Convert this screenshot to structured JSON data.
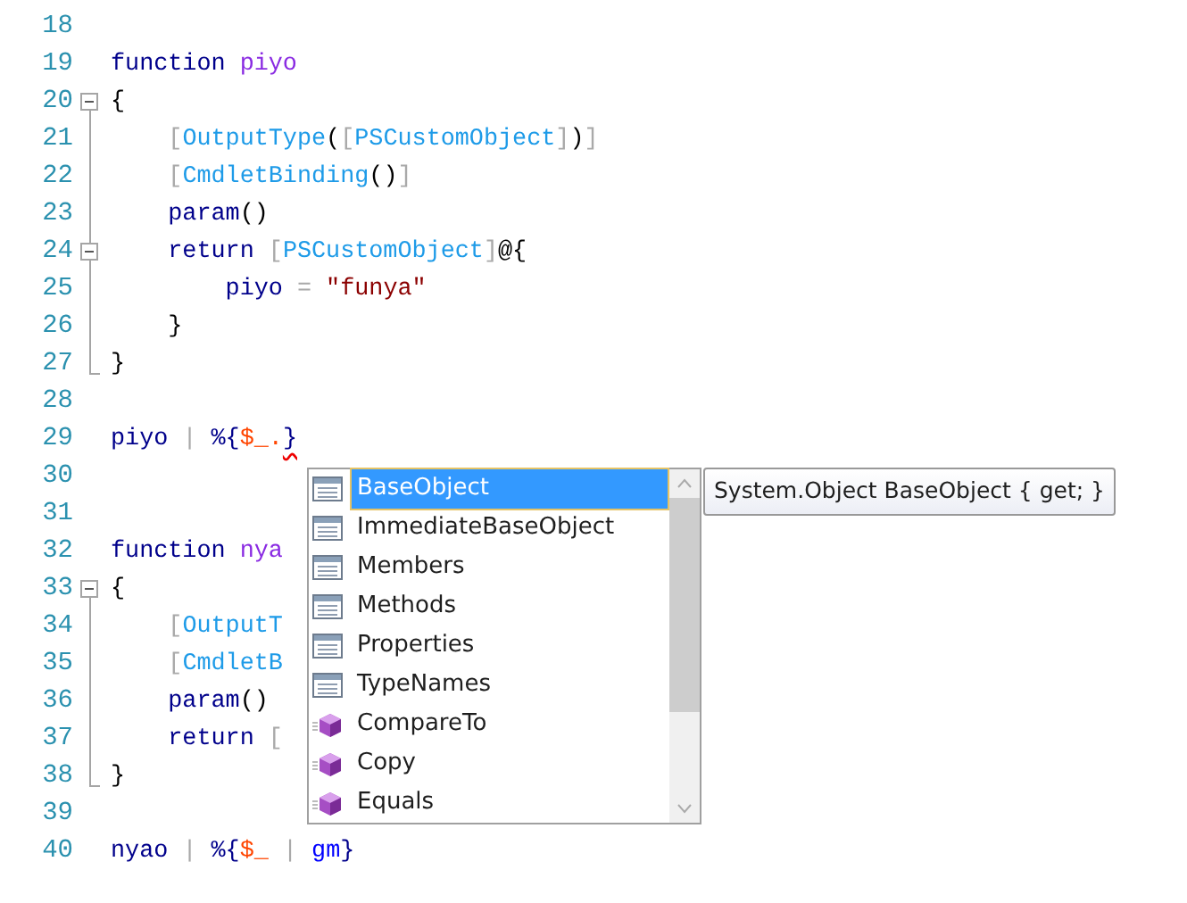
{
  "editor": {
    "lines": [
      {
        "number": "18"
      },
      {
        "number": "19",
        "tokens": [
          {
            "t": "function ",
            "kind": "keyword"
          },
          {
            "t": "piyo",
            "kind": "name"
          }
        ]
      },
      {
        "number": "20",
        "collapsible": true,
        "tokens": [
          {
            "t": "{",
            "kind": "punct"
          }
        ]
      },
      {
        "number": "21",
        "tokens": [
          {
            "t": "    [",
            "kind": "bracket"
          },
          {
            "t": "OutputType",
            "kind": "type"
          },
          {
            "t": "(",
            "kind": "punct"
          },
          {
            "t": "[",
            "kind": "bracket"
          },
          {
            "t": "PSCustomObject",
            "kind": "type"
          },
          {
            "t": "]",
            "kind": "bracket"
          },
          {
            "t": ")",
            "kind": "punct"
          },
          {
            "t": "]",
            "kind": "bracket"
          }
        ]
      },
      {
        "number": "22",
        "tokens": [
          {
            "t": "    [",
            "kind": "bracket"
          },
          {
            "t": "CmdletBinding",
            "kind": "type"
          },
          {
            "t": "()",
            "kind": "punct"
          },
          {
            "t": "]",
            "kind": "bracket"
          }
        ]
      },
      {
        "number": "23",
        "tokens": [
          {
            "t": "    param",
            "kind": "keyword"
          },
          {
            "t": "()",
            "kind": "punct"
          }
        ]
      },
      {
        "number": "24",
        "collapsible": true,
        "tokens": [
          {
            "t": "    return",
            "kind": "keyword"
          },
          {
            "t": " [",
            "kind": "bracket"
          },
          {
            "t": "PSCustomObject",
            "kind": "type"
          },
          {
            "t": "]",
            "kind": "bracket"
          },
          {
            "t": "@{",
            "kind": "punct"
          }
        ]
      },
      {
        "number": "25",
        "tokens": [
          {
            "t": "        piyo",
            "kind": "keyword"
          },
          {
            "t": " = ",
            "kind": "operator"
          },
          {
            "t": "\"funya\"",
            "kind": "string"
          }
        ]
      },
      {
        "number": "26",
        "tokens": [
          {
            "t": "    }",
            "kind": "punct"
          }
        ]
      },
      {
        "number": "27",
        "fold_end": true,
        "tokens": [
          {
            "t": "}",
            "kind": "punct"
          }
        ]
      },
      {
        "number": "28"
      },
      {
        "number": "29",
        "tokens": [
          {
            "t": "piyo",
            "kind": "keyword"
          },
          {
            "t": " | ",
            "kind": "operator"
          },
          {
            "t": "%{",
            "kind": "keyword"
          },
          {
            "t": "$_.",
            "kind": "variable"
          },
          {
            "t": "}",
            "kind": "keyword",
            "error": true
          }
        ]
      },
      {
        "number": "30"
      },
      {
        "number": "31"
      },
      {
        "number": "32",
        "tokens": [
          {
            "t": "function ",
            "kind": "keyword"
          },
          {
            "t": "nya",
            "kind": "name"
          }
        ]
      },
      {
        "number": "33",
        "collapsible": true,
        "tokens": [
          {
            "t": "{",
            "kind": "punct"
          }
        ]
      },
      {
        "number": "34",
        "tokens": [
          {
            "t": "    [",
            "kind": "bracket"
          },
          {
            "t": "OutputT",
            "kind": "type"
          }
        ]
      },
      {
        "number": "35",
        "tokens": [
          {
            "t": "    [",
            "kind": "bracket"
          },
          {
            "t": "CmdletB",
            "kind": "type"
          }
        ]
      },
      {
        "number": "36",
        "tokens": [
          {
            "t": "    param",
            "kind": "keyword"
          },
          {
            "t": "()",
            "kind": "punct"
          }
        ]
      },
      {
        "number": "37",
        "tokens": [
          {
            "t": "    return",
            "kind": "keyword"
          },
          {
            "t": " [",
            "kind": "bracket"
          }
        ]
      },
      {
        "number": "38",
        "fold_end": true,
        "tokens": [
          {
            "t": "}",
            "kind": "punct"
          }
        ]
      },
      {
        "number": "39"
      },
      {
        "number": "40",
        "tokens": [
          {
            "t": "nyao",
            "kind": "keyword"
          },
          {
            "t": " | ",
            "kind": "operator"
          },
          {
            "t": "%{",
            "kind": "keyword"
          },
          {
            "t": "$_",
            "kind": "variable"
          },
          {
            "t": " | ",
            "kind": "operator"
          },
          {
            "t": "gm",
            "kind": "command"
          },
          {
            "t": "}",
            "kind": "keyword"
          }
        ]
      }
    ]
  },
  "completion": {
    "items": [
      {
        "label": "BaseObject",
        "kind": "property",
        "selected": true
      },
      {
        "label": "ImmediateBaseObject",
        "kind": "property",
        "selected": false
      },
      {
        "label": "Members",
        "kind": "property",
        "selected": false
      },
      {
        "label": "Methods",
        "kind": "property",
        "selected": false
      },
      {
        "label": "Properties",
        "kind": "property",
        "selected": false
      },
      {
        "label": "TypeNames",
        "kind": "property",
        "selected": false
      },
      {
        "label": "CompareTo",
        "kind": "method",
        "selected": false
      },
      {
        "label": "Copy",
        "kind": "method",
        "selected": false
      },
      {
        "label": "Equals",
        "kind": "method",
        "selected": false
      }
    ]
  },
  "tooltip": {
    "text": "System.Object BaseObject { get; }"
  }
}
